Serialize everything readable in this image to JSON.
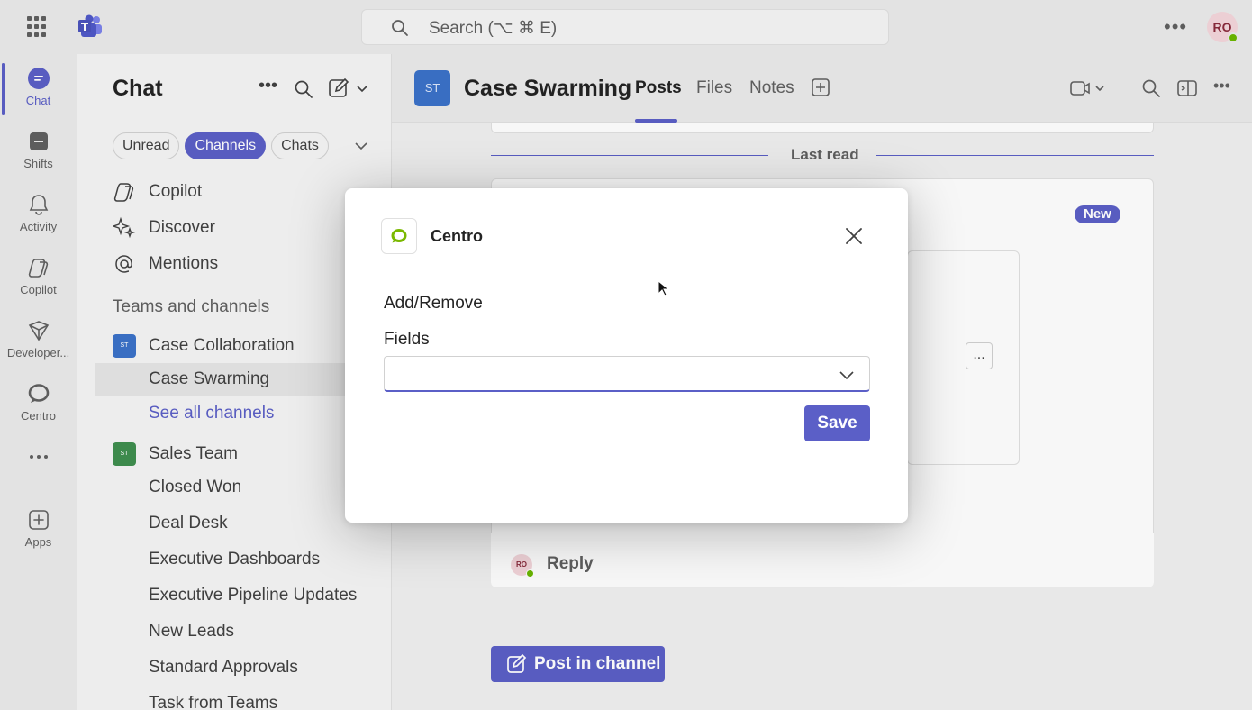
{
  "search": {
    "placeholder": "Search (⌥ ⌘ E)"
  },
  "user": {
    "initials": "RO"
  },
  "rail": {
    "items": [
      {
        "label": "Chat"
      },
      {
        "label": "Shifts"
      },
      {
        "label": "Activity"
      },
      {
        "label": "Copilot"
      },
      {
        "label": "Developer..."
      },
      {
        "label": "Centro"
      },
      {
        "label": "Apps"
      }
    ]
  },
  "chatpane": {
    "title": "Chat",
    "filters": [
      "Unread",
      "Channels",
      "Chats"
    ],
    "nav": [
      "Copilot",
      "Discover",
      "Mentions"
    ],
    "section": "Teams and channels",
    "teams": [
      {
        "badge": "ST",
        "name": "Case Collaboration",
        "color": "#3b72c9"
      },
      {
        "badge": "ST",
        "name": "Sales Team",
        "color": "#3f8f4f"
      }
    ],
    "channels": {
      "case": [
        "Case Swarming",
        "See all channels"
      ],
      "sales": [
        "Closed Won",
        "Deal Desk",
        "Executive Dashboards",
        "Executive Pipeline Updates",
        "New Leads",
        "Standard Approvals",
        "Task from Teams"
      ]
    }
  },
  "channel": {
    "badge": "ST",
    "title": "Case Swarming",
    "tabs": [
      "Posts",
      "Files",
      "Notes"
    ],
    "last_read": "Last read",
    "new_label": "New",
    "ellipsis": "...",
    "reply_avatar": "RO",
    "reply_label": "Reply",
    "post_button": "Post in channel"
  },
  "modal": {
    "app_name": "Centro",
    "label_add_remove": "Add/Remove",
    "label_fields": "Fields",
    "fields_value": "",
    "save_label": "Save"
  },
  "colors": {
    "accent": "#5b5fc7",
    "presence": "#6bb700",
    "centro": "#7ab800"
  }
}
